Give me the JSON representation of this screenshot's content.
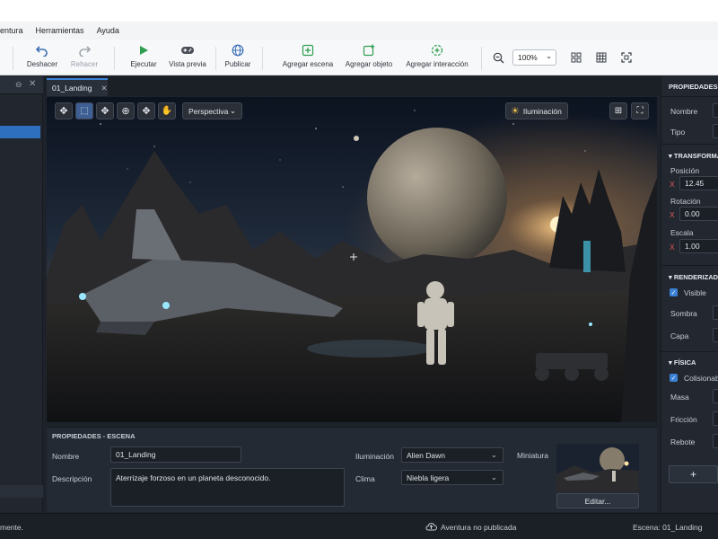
{
  "menubar": {
    "items": [
      "entura",
      "Herramientas",
      "Ayuda"
    ]
  },
  "toolbar": {
    "undo_label": "Deshacer",
    "redo_label": "Rehacer",
    "run_label": "Ejecutar",
    "preview_label": "Vista previa",
    "publish_label": "Publicar",
    "add_scene_label": "Agregar escena",
    "add_object_label": "Agregar objeto",
    "add_interaction_label": "Agregar interacción",
    "zoom_value": "100%"
  },
  "tabs": {
    "active_label": "01_Landing"
  },
  "viewport": {
    "camera_mode": "Perspectiva",
    "lighting_button": "Iluminación"
  },
  "scene_properties": {
    "title": "PROPIEDADES - ESCENA",
    "name_label": "Nombre",
    "name_value": "01_Landing",
    "description_label": "Descripción",
    "description_value": "Aterrizaje forzoso en un planeta desconocido.",
    "lighting_label": "Iluminación",
    "lighting_value": "Alien Dawn",
    "climate_label": "Clima",
    "climate_value": "Niebla ligera",
    "thumbnail_label": "Miniatura",
    "edit_button": "Editar..."
  },
  "right_panel": {
    "title": "PROPIEDADES - O",
    "name_label": "Nombre",
    "type_label": "Tipo",
    "transform_title": "TRANSFORMA",
    "position_label": "Posición",
    "position_x": "12.45",
    "rotation_label": "Rotación",
    "rotation_x": "0.00",
    "scale_label": "Escala",
    "scale_x": "1.00",
    "axis_x": "X",
    "render_title": "RENDERIZADO",
    "visible_label": "Visible",
    "shadow_label": "Sombra",
    "layer_label": "Capa",
    "physics_title": "FÍSICA",
    "collidable_label": "Colisionabl",
    "mass_label": "Masa",
    "friction_label": "Fricción",
    "bounce_label": "Rebote",
    "add_symbol": "+"
  },
  "statusbar": {
    "left_text": "mente.",
    "publish_status": "Aventura no publicada",
    "scene_status": "Escena: 01_Landing"
  },
  "colors": {
    "accent": "#3b82d6",
    "panel_bg": "#232830",
    "toolbar_bg": "#f7f8fa"
  }
}
